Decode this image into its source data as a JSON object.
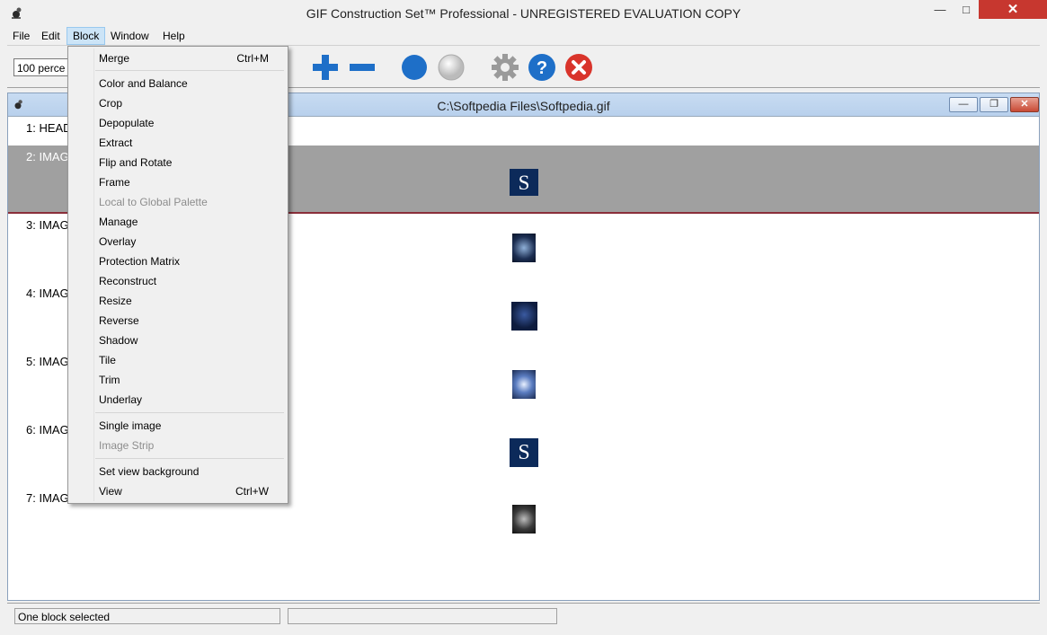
{
  "window": {
    "title": "GIF Construction Set™ Professional - UNREGISTERED EVALUATION COPY"
  },
  "menubar": [
    "File",
    "Edit",
    "Block",
    "Window",
    "Help"
  ],
  "toolbar": {
    "zoom_value": "100 perce"
  },
  "document": {
    "title": "C:\\Softpedia Files\\Softpedia.gif",
    "rows": [
      {
        "label": "1: HEAD"
      },
      {
        "label": "2: IMAG"
      },
      {
        "label": "3: IMAG"
      },
      {
        "label": "4: IMAG"
      },
      {
        "label": "5: IMAG"
      },
      {
        "label": "6: IMAG"
      },
      {
        "label": "7: IMAG"
      }
    ],
    "thumb_letter": "S"
  },
  "block_menu": {
    "items": [
      {
        "label": "Merge",
        "shortcut": "Ctrl+M",
        "enabled": true
      },
      {
        "label": "Color and Balance",
        "shortcut": "",
        "enabled": true
      },
      {
        "label": "Crop",
        "shortcut": "",
        "enabled": true
      },
      {
        "label": "Depopulate",
        "shortcut": "",
        "enabled": true
      },
      {
        "label": "Extract",
        "shortcut": "",
        "enabled": true
      },
      {
        "label": "Flip and Rotate",
        "shortcut": "",
        "enabled": true
      },
      {
        "label": "Frame",
        "shortcut": "",
        "enabled": true
      },
      {
        "label": "Local to Global Palette",
        "shortcut": "",
        "enabled": false
      },
      {
        "label": "Manage",
        "shortcut": "",
        "enabled": true
      },
      {
        "label": "Overlay",
        "shortcut": "",
        "enabled": true
      },
      {
        "label": "Protection Matrix",
        "shortcut": "",
        "enabled": true
      },
      {
        "label": "Reconstruct",
        "shortcut": "",
        "enabled": true
      },
      {
        "label": "Resize",
        "shortcut": "",
        "enabled": true
      },
      {
        "label": "Reverse",
        "shortcut": "",
        "enabled": true
      },
      {
        "label": "Shadow",
        "shortcut": "",
        "enabled": true
      },
      {
        "label": "Tile",
        "shortcut": "",
        "enabled": true
      },
      {
        "label": "Trim",
        "shortcut": "",
        "enabled": true
      },
      {
        "label": "Underlay",
        "shortcut": "",
        "enabled": true
      },
      {
        "label": "Single image",
        "shortcut": "",
        "enabled": true
      },
      {
        "label": "Image Strip",
        "shortcut": "",
        "enabled": false
      },
      {
        "label": "Set view background",
        "shortcut": "",
        "enabled": true
      },
      {
        "label": "View",
        "shortcut": "Ctrl+W",
        "enabled": true
      }
    ]
  },
  "status": {
    "left": "One block selected",
    "right": ""
  },
  "colors": {
    "accent_blue": "#1e6fc8",
    "close_red": "#d9342b",
    "selected_row": "#a0a0a0"
  }
}
